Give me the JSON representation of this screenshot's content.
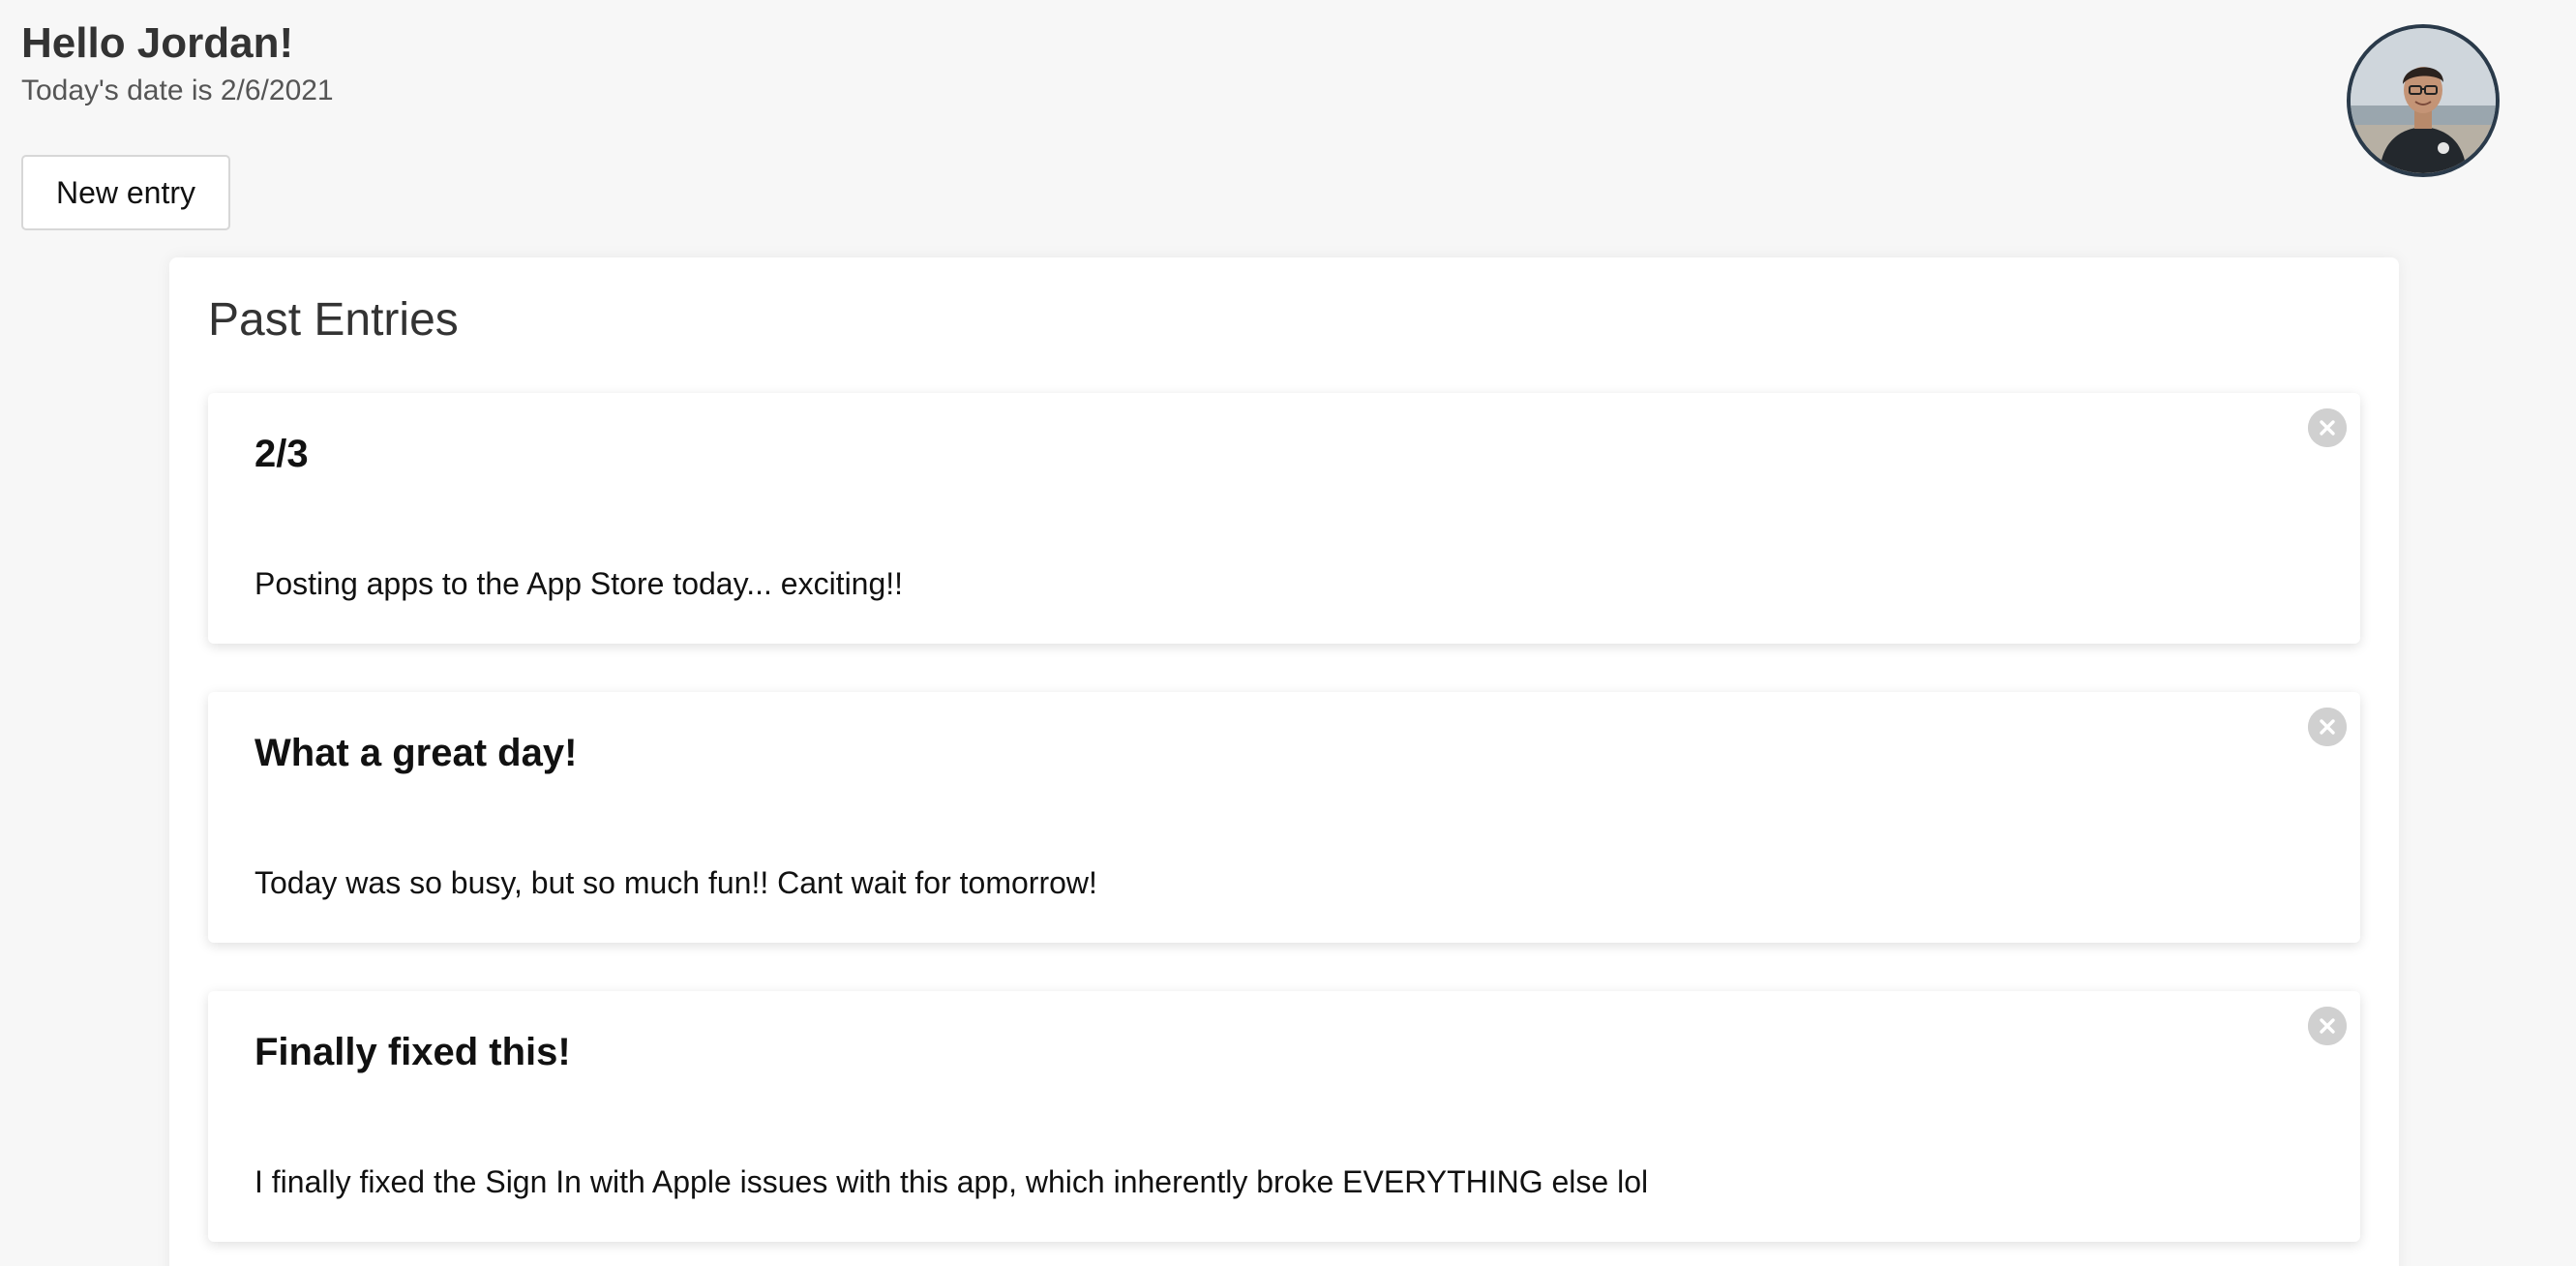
{
  "header": {
    "greeting": "Hello Jordan!",
    "date_text": "Today's date is 2/6/2021",
    "new_entry_label": "New entry"
  },
  "avatar": {
    "alt": "profile photo",
    "border_color": "#2a3a4a"
  },
  "panel": {
    "title": "Past Entries"
  },
  "entries": [
    {
      "title": "2/3",
      "body": "Posting apps to the App Store today... exciting!!"
    },
    {
      "title": "What a great day!",
      "body": "Today was so busy, but so much fun!! Cant wait for tomorrow!"
    },
    {
      "title": "Finally fixed this!",
      "body": "I finally fixed the Sign In with Apple issues with this app, which inherently broke EVERYTHING else lol"
    }
  ],
  "icons": {
    "delete": "close-circle-icon"
  },
  "colors": {
    "background": "#f7f7f7",
    "card": "#ffffff",
    "delete_icon": "#d0d0d0"
  }
}
